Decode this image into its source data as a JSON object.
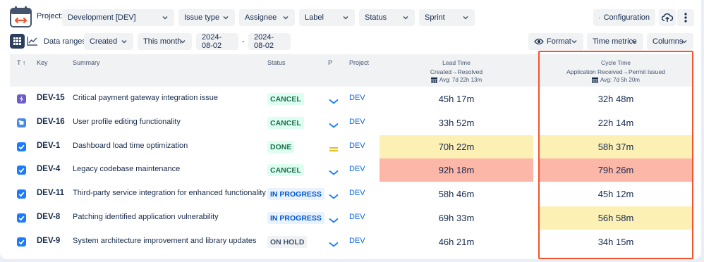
{
  "toolbar": {
    "project_label": "Project:",
    "project_value": "Development [DEV]",
    "filters": [
      "Issue type",
      "Assignee",
      "Label",
      "Status",
      "Sprint"
    ],
    "configuration_label": "Configuration"
  },
  "toolbar2": {
    "data_ranges_label": "Data ranges:",
    "range_field": "Created",
    "range_period": "This month",
    "date_from": "2024-08-02",
    "date_sep": "-",
    "date_to": "2024-08-02",
    "format_label": "Format",
    "time_metrics_label": "Time metrics",
    "columns_label": "Columns"
  },
  "table": {
    "headers": {
      "type": "T",
      "key": "Key",
      "summary": "Summary",
      "status": "Status",
      "priority": "P",
      "project": "Project",
      "lead_title": "Lead Time",
      "lead_sub": "Created→Resolved",
      "lead_avg": "Avg: 7d 22h 13m",
      "cycle_title": "Cycle Time",
      "cycle_sub": "Application Received→Permit Issued",
      "cycle_avg": "Avg: 7d 5h 20m"
    },
    "rows": [
      {
        "type": "epic",
        "key": "DEV-15",
        "summary": "Critical payment gateway integration issue",
        "status": "CANCEL",
        "status_kind": "cancel",
        "priority": "low",
        "project": "DEV",
        "lead": "45h 17m",
        "lead_color": "none",
        "cycle": "32h 48m",
        "cycle_color": "none"
      },
      {
        "type": "story",
        "key": "DEV-16",
        "summary": "User profile editing functionality",
        "status": "CANCEL",
        "status_kind": "cancel",
        "priority": "low",
        "project": "DEV",
        "lead": "33h 52m",
        "lead_color": "none",
        "cycle": "22h 14m",
        "cycle_color": "none"
      },
      {
        "type": "task",
        "key": "DEV-1",
        "summary": "Dashboard load time optimization",
        "status": "DONE",
        "status_kind": "done",
        "priority": "medium",
        "project": "DEV",
        "lead": "70h 22m",
        "lead_color": "yellow",
        "cycle": "58h 37m",
        "cycle_color": "yellow"
      },
      {
        "type": "task",
        "key": "DEV-4",
        "summary": "Legacy codebase maintenance",
        "status": "CANCEL",
        "status_kind": "cancel",
        "priority": "low",
        "project": "DEV",
        "lead": "92h 18m",
        "lead_color": "red",
        "cycle": "79h 26m",
        "cycle_color": "red"
      },
      {
        "type": "task",
        "key": "DEV-11",
        "summary": "Third-party service integration for enhanced functionality",
        "status": "IN PROGRESS",
        "status_kind": "prog",
        "priority": "low",
        "project": "DEV",
        "lead": "58h 46m",
        "lead_color": "none",
        "cycle": "45h 12m",
        "cycle_color": "none"
      },
      {
        "type": "task",
        "key": "DEV-8",
        "summary": "Patching identified application vulnerability",
        "status": "IN PROGRESS",
        "status_kind": "prog",
        "priority": "low",
        "project": "DEV",
        "lead": "69h 33m",
        "lead_color": "none",
        "cycle": "56h 58m",
        "cycle_color": "yellow"
      },
      {
        "type": "task",
        "key": "DEV-9",
        "summary": "System architecture improvement and library updates",
        "status": "ON HOLD",
        "status_kind": "hold",
        "priority": "low",
        "project": "DEV",
        "lead": "46h 21m",
        "lead_color": "none",
        "cycle": "34h 15m",
        "cycle_color": "none"
      }
    ]
  },
  "colors": {
    "yellow": "#fdf0b5",
    "red": "#fdb7a8",
    "highlight_border": "#f4532f",
    "link": "#0c66e4"
  }
}
